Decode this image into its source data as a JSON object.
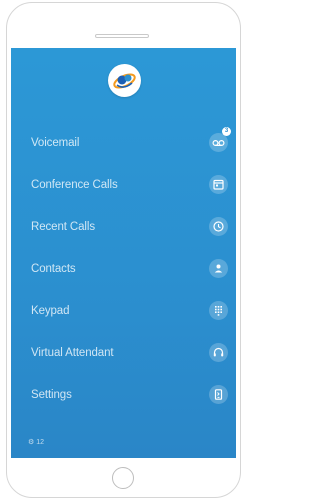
{
  "menu": {
    "items": [
      {
        "label": "Voicemail",
        "icon": "voicemail-icon",
        "badge": "3"
      },
      {
        "label": "Conference Calls",
        "icon": "calendar-icon"
      },
      {
        "label": "Recent Calls",
        "icon": "clock-icon"
      },
      {
        "label": "Contacts",
        "icon": "contact-person-icon"
      },
      {
        "label": "Keypad",
        "icon": "keypad-icon"
      },
      {
        "label": "Virtual Attendant",
        "icon": "headset-icon"
      },
      {
        "label": "Settings",
        "icon": "settings-device-icon"
      }
    ]
  },
  "footer": {
    "status_text": "⚙ 12"
  },
  "colors": {
    "screen": "#2b8fcf",
    "logo_blue": "#1c5fb4",
    "logo_orange": "#f39a1e"
  }
}
